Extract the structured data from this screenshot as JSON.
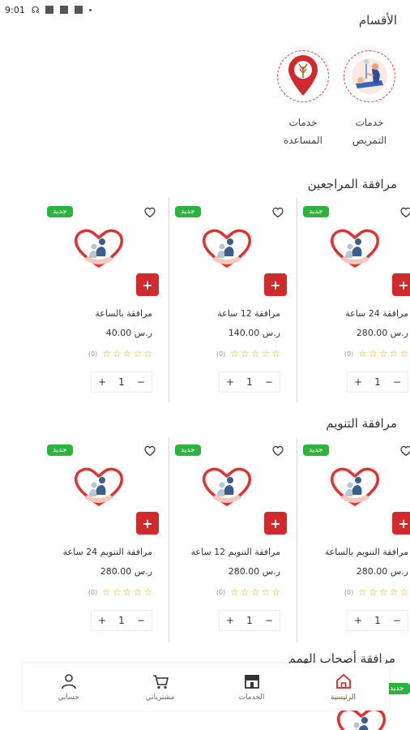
{
  "status": {
    "time": "9:01"
  },
  "categories": {
    "title": "الأقسام",
    "items": [
      {
        "line1": "خدمات",
        "line2": "التمريض",
        "icon": "nurse-icon"
      },
      {
        "line1": "خدمات",
        "line2": "المساعدة",
        "icon": "location-pin-icon"
      }
    ]
  },
  "sections": [
    {
      "title": "مرافقة المراجعين",
      "products": [
        {
          "name": "مرافقة 24 ساعة",
          "price": "ر.س 280.00",
          "badge": "جديد",
          "rating_count": "(0)",
          "qty": "1"
        },
        {
          "name": "مرافقة 12 ساعة",
          "price": "ر.س 140.00",
          "badge": "جديد",
          "rating_count": "(0)",
          "qty": "1"
        },
        {
          "name": "مرافقة بالساعة",
          "price": "ر.س 40.00",
          "badge": "جديد",
          "rating_count": "(0)",
          "qty": "1"
        }
      ]
    },
    {
      "title": "مرافقة التنويم",
      "products": [
        {
          "name": "مرافقة التنويم بالساعة",
          "price": "ر.س 280.00",
          "badge": "جديد",
          "rating_count": "(0)",
          "qty": "1"
        },
        {
          "name": "مرافقة التنويم 12 ساعة",
          "price": "ر.س 280.00",
          "badge": "جديد",
          "rating_count": "(0)",
          "qty": "1"
        },
        {
          "name": "مرافقة التنويم 24 ساعة",
          "price": "ر.س 280.00",
          "badge": "جديد",
          "rating_count": "(0)",
          "qty": "1"
        }
      ]
    }
  ],
  "nav": {
    "items": [
      {
        "label": "الرئيسية",
        "icon": "home-icon",
        "active": true
      },
      {
        "label": "الخدمات",
        "icon": "store-icon",
        "active": false
      },
      {
        "label": "مشترياتي",
        "icon": "cart-icon",
        "active": false
      },
      {
        "label": "حسابي",
        "icon": "user-icon",
        "active": false
      }
    ]
  },
  "peek": {
    "title": "مرافقة أصحاب الهمم",
    "badge": "جديد"
  },
  "colors": {
    "accent": "#d12a2c",
    "badge": "#2eb23f",
    "star": "#f2a21b"
  }
}
